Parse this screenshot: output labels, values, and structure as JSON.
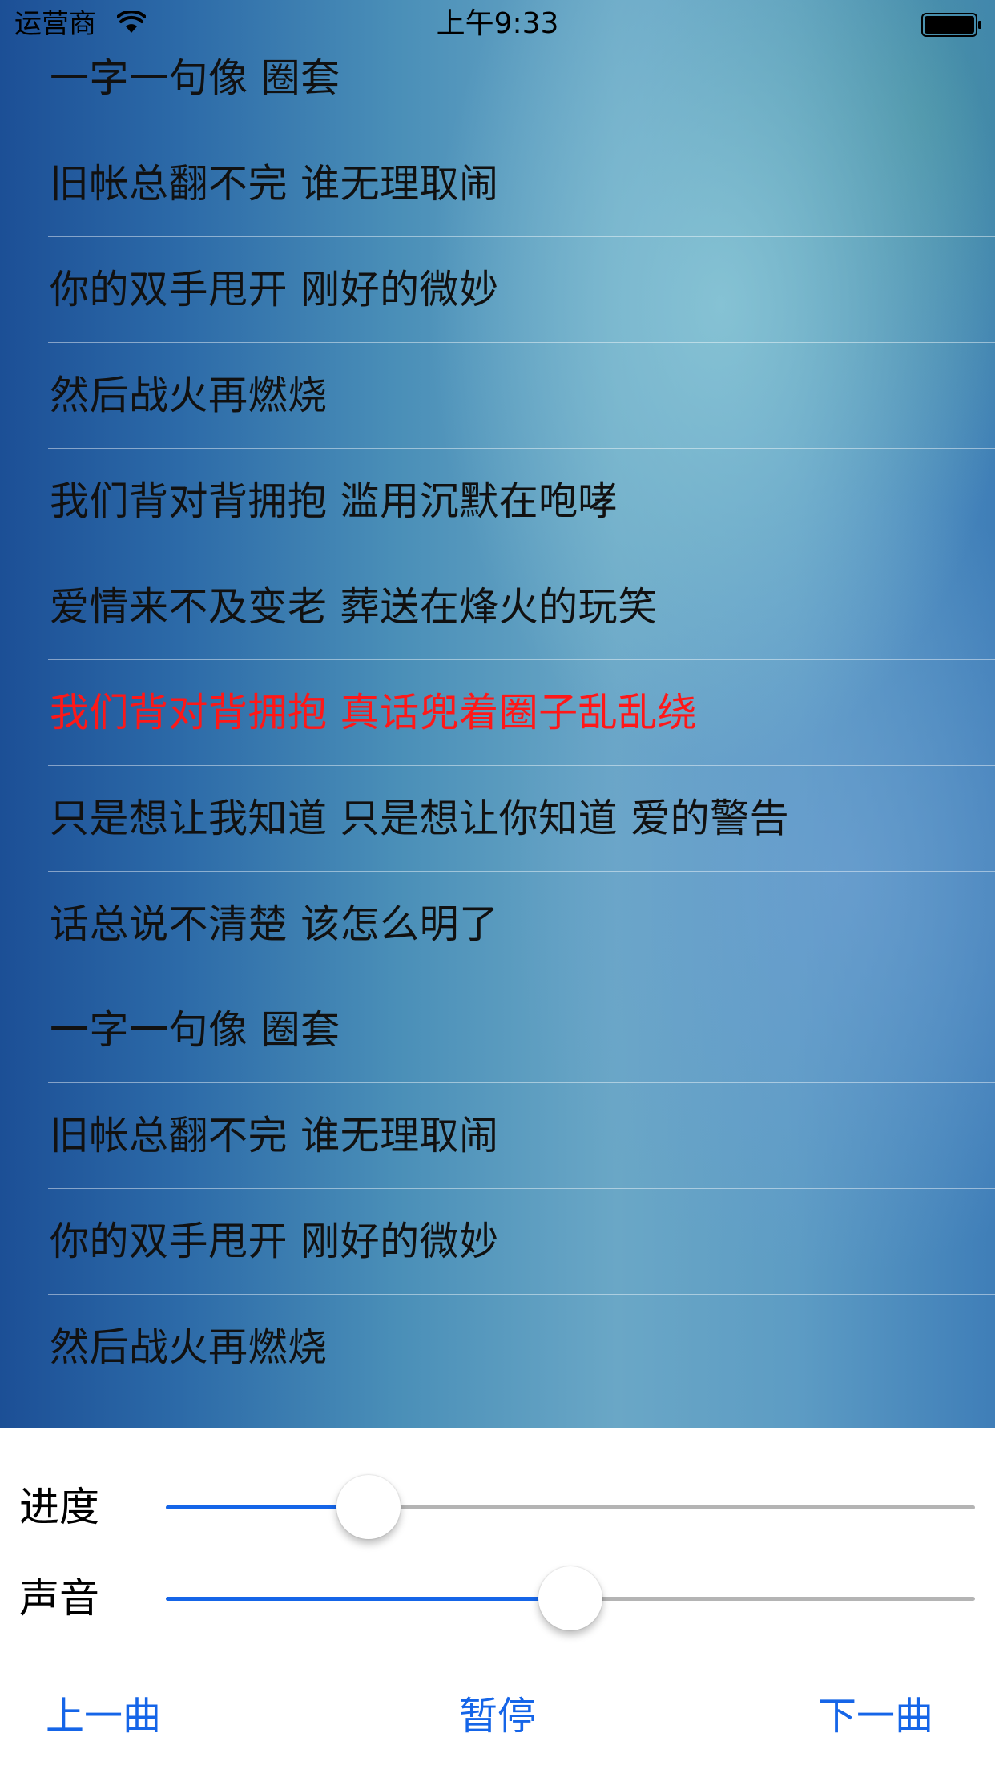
{
  "status_bar": {
    "carrier": "运营商",
    "time": "上午9:33",
    "wifi_icon": "wifi-icon",
    "battery_icon": "battery-icon"
  },
  "lyrics": {
    "current_index": 6,
    "current_color": "#ff1818",
    "lines": [
      "一字一句像 圈套",
      "旧帐总翻不完 谁无理取闹",
      "你的双手甩开 刚好的微妙",
      "然后战火再燃烧",
      "我们背对背拥抱 滥用沉默在咆哮",
      "爱情来不及变老 葬送在烽火的玩笑",
      "我们背对背拥抱 真话兜着圈子乱乱绕",
      "只是想让我知道 只是想让你知道 爱的警告",
      "话总说不清楚 该怎么明了",
      "一字一句像 圈套",
      "旧帐总翻不完 谁无理取闹",
      "你的双手甩开 刚好的微妙",
      "然后战火再燃烧"
    ]
  },
  "controls": {
    "progress": {
      "label": "进度",
      "value": 0.25
    },
    "volume": {
      "label": "声音",
      "value": 0.5
    },
    "accent_color": "#1565e8",
    "prev_label": "上一曲",
    "pause_label": "暂停",
    "next_label": "下一曲"
  }
}
